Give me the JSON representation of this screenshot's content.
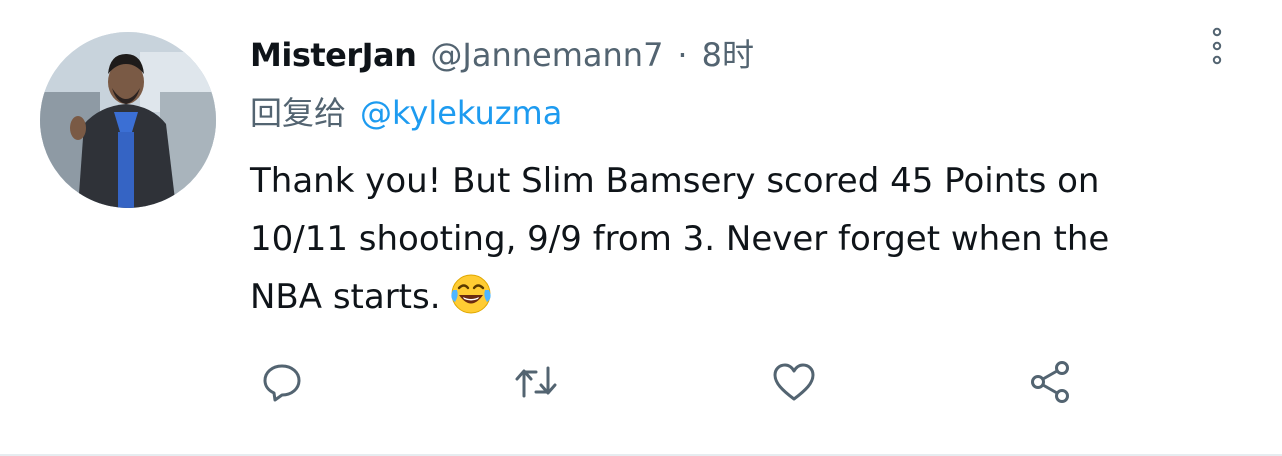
{
  "tweet": {
    "display_name": "MisterJan",
    "handle": "@Jannemann7",
    "separator": "·",
    "time": "8时",
    "reply_prefix": "回复给",
    "reply_to": "@kylekuzma",
    "body_lines": [
      "Thank you! But Slim Bamsery scored 45 Points on",
      "10/11 shooting, 9/9 from 3. Never forget when the",
      "NBA starts."
    ],
    "emoji": "face-with-tears-of-joy"
  },
  "actions": [
    {
      "name": "reply",
      "icon": "reply-icon"
    },
    {
      "name": "retweet",
      "icon": "retweet-icon"
    },
    {
      "name": "like",
      "icon": "heart-icon"
    },
    {
      "name": "share",
      "icon": "share-icon"
    }
  ],
  "colors": {
    "text_primary": "#0f1419",
    "text_secondary": "#536471",
    "accent": "#1d9bf0",
    "icon": "#536471"
  }
}
